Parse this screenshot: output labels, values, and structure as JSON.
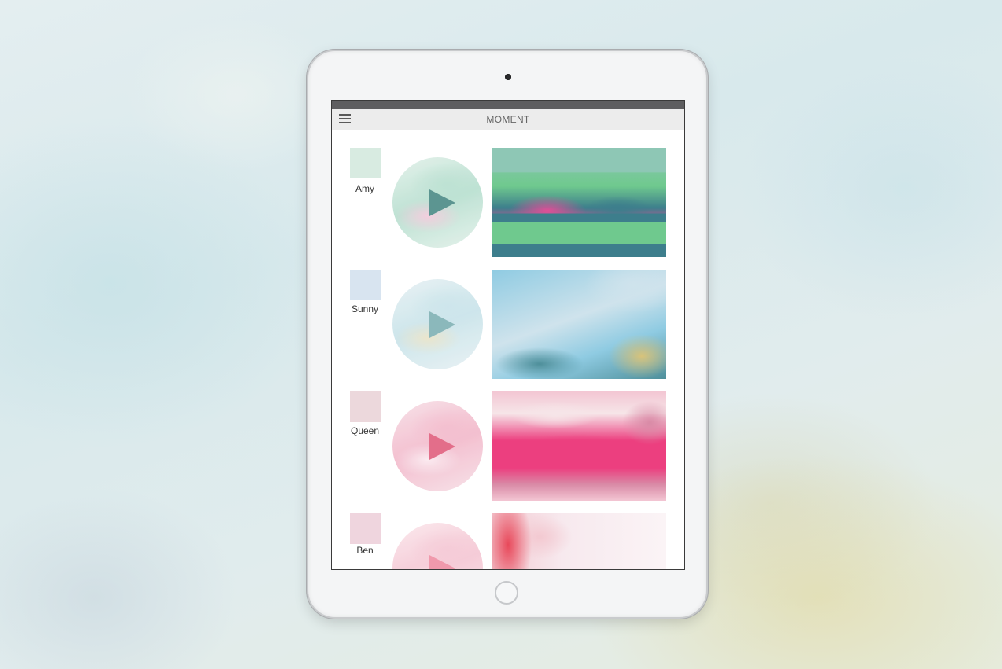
{
  "app": {
    "title": "MOMENT",
    "menu_icon": "hamburger-menu-icon"
  },
  "device": {
    "camera": "camera-icon",
    "home_button": "home-button"
  },
  "moments": [
    {
      "name": "Amy",
      "swatch_color": "#d8ebe1",
      "circle_colors": [
        "#e3f1ea",
        "#b7dfcf",
        "#f2c9db"
      ],
      "play_color": "#4b8a86",
      "painting_colors": [
        "#8ec7b5",
        "#6fc98e",
        "#e04f97",
        "#3d7e8c"
      ]
    },
    {
      "name": "Sunny",
      "swatch_color": "#d8e4f0",
      "circle_colors": [
        "#e7f1f3",
        "#c8e3ea",
        "#e9e3c7"
      ],
      "play_color": "#7fb1b4",
      "painting_colors": [
        "#8fcbe2",
        "#cfe3ec",
        "#d8c37a",
        "#4e8f9a"
      ]
    },
    {
      "name": "Queen",
      "swatch_color": "#ecd8dc",
      "circle_colors": [
        "#f7dfe6",
        "#f2b9cb",
        "#fbe9ef"
      ],
      "play_color": "#e05f7e",
      "painting_colors": [
        "#f3c6d3",
        "#ec3f7f",
        "#f6e5e8",
        "#d98aa6"
      ]
    },
    {
      "name": "Ben",
      "swatch_color": "#efd5de",
      "circle_colors": [
        "#fbe7ec",
        "#f5c6d3",
        "#fdf2f4"
      ],
      "play_color": "#ef8fa4",
      "painting_colors": [
        "#e8485a",
        "#f3c9d1",
        "#f7e9ee",
        "#fbf4f6"
      ]
    }
  ]
}
